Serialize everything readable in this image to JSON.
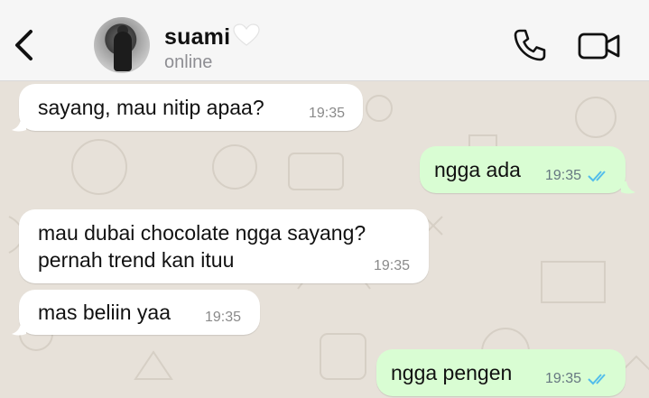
{
  "header": {
    "contact_name": "suami",
    "status": "online",
    "icons": {
      "back": "chevron-left-icon",
      "heart": "white-heart-icon",
      "call": "phone-icon",
      "video": "video-camera-icon"
    }
  },
  "messages": [
    {
      "direction": "incoming",
      "text": "sayang, mau nitip apaa?",
      "time": "19:35"
    },
    {
      "direction": "outgoing",
      "text": "ngga ada",
      "time": "19:35",
      "read": true
    },
    {
      "direction": "incoming",
      "text": "mau dubai chocolate ngga sayang?\npernah trend kan ituu",
      "time": "19:35"
    },
    {
      "direction": "incoming",
      "text": "mas beliin yaa",
      "time": "19:35"
    },
    {
      "direction": "outgoing",
      "text": "ngga pengen",
      "time": "19:35",
      "read": true
    }
  ],
  "colors": {
    "header_bg": "#f6f6f6",
    "wallpaper_bg": "#e7e1d9",
    "incoming_bubble": "#ffffff",
    "outgoing_bubble": "#d9fdd3",
    "read_ticks": "#53bdeb"
  }
}
